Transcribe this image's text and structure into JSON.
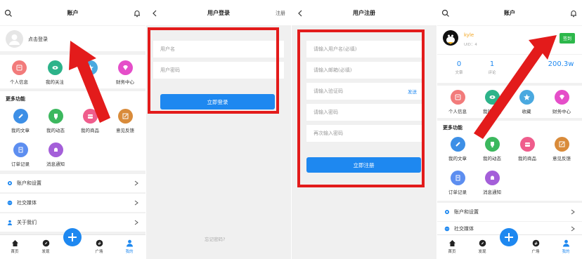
{
  "colors": {
    "accent": "#1e88f0",
    "arrow": "#e31b1b",
    "signin": "#2db84b"
  },
  "panel_account": {
    "title": "账户",
    "login_prompt": "点击登录",
    "quick_items": [
      {
        "label": "个人信息",
        "icon": "user-card-icon",
        "color": "#f27b7b"
      },
      {
        "label": "我的关注",
        "icon": "eye-icon",
        "color": "#2db38a"
      },
      {
        "label": "收藏",
        "icon": "star-icon",
        "color": "#4aa9e0"
      },
      {
        "label": "财务中心",
        "icon": "diamond-icon",
        "color": "#e54ec9"
      }
    ],
    "more_title": "更多功能",
    "more_items": [
      {
        "label": "我的文章",
        "icon": "pencil-icon",
        "color": "#3d8fe6"
      },
      {
        "label": "我的动态",
        "icon": "cup-icon",
        "color": "#3cb85e"
      },
      {
        "label": "我的商品",
        "icon": "bag-icon",
        "color": "#ef5d8c"
      },
      {
        "label": "意见反馈",
        "icon": "edit-box-icon",
        "color": "#d98b3a"
      },
      {
        "label": "订单记录",
        "icon": "document-icon",
        "color": "#5d8ef0"
      },
      {
        "label": "消息通知",
        "icon": "bell-icon",
        "color": "#a45fd9"
      }
    ],
    "menu": [
      {
        "label": "账户和设置",
        "icon": "gear-icon"
      },
      {
        "label": "社交媒体",
        "icon": "chat-icon"
      },
      {
        "label": "关于我们",
        "icon": "person-icon"
      }
    ]
  },
  "tabs": [
    {
      "label": "首页",
      "icon": "home-icon"
    },
    {
      "label": "发现",
      "icon": "compass-icon"
    },
    {
      "label": "广场",
      "icon": "hash-icon"
    },
    {
      "label": "我的",
      "icon": "person-icon"
    }
  ],
  "panel_login": {
    "title": "用户登录",
    "register_link": "注册",
    "username_placeholder": "用户名",
    "password_placeholder": "用户密码",
    "login_button": "立即登录",
    "forgot": "忘记密码?"
  },
  "panel_register": {
    "title": "用户注册",
    "username_placeholder": "请输入用户名(必填)",
    "email_placeholder": "请输入邮箱(必填)",
    "code_placeholder": "请输入验证码",
    "send_code": "发送",
    "password_placeholder": "请输入密码",
    "repeat_placeholder": "再次输入密码",
    "register_button": "立即注册"
  },
  "panel_profile": {
    "title": "账户",
    "username": "kyle",
    "uid": "UID：4",
    "signin_button": "签到",
    "stats": [
      {
        "value": "0",
        "label": "文章"
      },
      {
        "value": "1",
        "label": "评论"
      },
      {
        "value": "0",
        "label": ""
      },
      {
        "value": "200.3w",
        "label": ""
      }
    ],
    "menu": [
      {
        "label": "账户和设置",
        "icon": "gear-icon"
      },
      {
        "label": "社交媒体",
        "icon": "chat-icon"
      }
    ]
  }
}
